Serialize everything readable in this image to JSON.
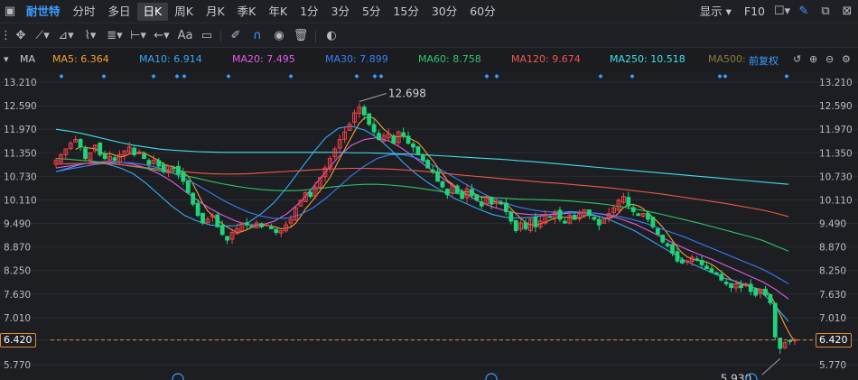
{
  "header": {
    "stock_name": "耐世特",
    "periods": [
      "分时",
      "多日",
      "日K",
      "周K",
      "月K",
      "季K",
      "年K",
      "1分",
      "3分",
      "5分",
      "15分",
      "30分",
      "60分"
    ],
    "active_period": "日K",
    "display_label": "显示",
    "f10_label": "F10"
  },
  "toolbar": {
    "text_tool_label": "Aa"
  },
  "indicator": {
    "label": "MA",
    "ma": [
      {
        "label": "MA5: 6.364",
        "color": "#f0a232"
      },
      {
        "label": "MA10: 6.914",
        "color": "#37a7f2"
      },
      {
        "label": "MA20: 7.495",
        "color": "#e05ce6"
      },
      {
        "label": "MA30: 7.899",
        "color": "#3a7df5"
      },
      {
        "label": "MA60: 8.758",
        "color": "#2fc46b"
      },
      {
        "label": "MA120: 9.674",
        "color": "#f0574d"
      },
      {
        "label": "MA250: 10.518",
        "color": "#3fe0e6"
      },
      {
        "label": "MA500:",
        "color": "#8a7b3c"
      }
    ],
    "adjust_label": "前复权"
  },
  "y_axis_labels": [
    "13.210",
    "12.590",
    "11.970",
    "11.350",
    "10.730",
    "10.110",
    "9.490",
    "8.870",
    "8.250",
    "7.630",
    "7.010",
    "6.420",
    "5.770"
  ],
  "price_tags": {
    "current_left": "6.420",
    "current_right": "6.420",
    "high_label": "12.698",
    "low_label": "5.930"
  },
  "colors": {
    "up": "#f0424a",
    "down": "#1fd37a",
    "current_line": "#e08a3c"
  },
  "chart_data": {
    "type": "candlestick",
    "y_range": [
      5.6,
      13.4
    ],
    "closes": [
      11.15,
      11.3,
      11.45,
      11.6,
      11.7,
      11.5,
      11.2,
      11.35,
      11.55,
      11.3,
      11.2,
      11.25,
      11.15,
      11.3,
      11.4,
      11.5,
      11.3,
      11.35,
      11.2,
      11.05,
      11.15,
      11.0,
      10.85,
      11.0,
      10.95,
      10.8,
      10.6,
      10.3,
      10.0,
      9.7,
      9.5,
      9.6,
      9.7,
      9.4,
      9.2,
      9.05,
      9.25,
      9.35,
      9.5,
      9.45,
      9.4,
      9.5,
      9.4,
      9.45,
      9.35,
      9.25,
      9.3,
      9.45,
      9.6,
      9.9,
      10.1,
      10.3,
      10.2,
      10.45,
      10.7,
      10.95,
      11.2,
      11.45,
      11.7,
      11.9,
      12.1,
      12.4,
      12.55,
      12.35,
      12.1,
      11.9,
      11.7,
      11.8,
      11.85,
      11.6,
      11.9,
      11.8,
      11.6,
      11.5,
      11.3,
      11.15,
      10.95,
      10.85,
      10.6,
      10.45,
      10.25,
      10.5,
      10.3,
      10.15,
      10.4,
      10.25,
      10.1,
      9.95,
      10.2,
      10.0,
      10.05,
      10.0,
      9.8,
      9.55,
      9.3,
      9.5,
      9.35,
      9.6,
      9.4,
      9.55,
      9.7,
      9.65,
      9.8,
      9.6,
      9.5,
      9.7,
      9.6,
      9.75,
      9.85,
      9.7,
      9.6,
      9.45,
      9.6,
      9.75,
      9.9,
      10.1,
      10.2,
      9.95,
      9.8,
      9.7,
      9.75,
      9.6,
      9.4,
      9.2,
      9.0,
      8.9,
      8.7,
      8.5,
      8.45,
      8.5,
      8.6,
      8.55,
      8.4,
      8.3,
      8.2,
      8.15,
      8.0,
      7.9,
      7.8,
      7.9,
      7.8,
      7.9,
      7.7,
      7.6,
      7.75,
      7.6,
      7.4,
      6.5,
      6.2,
      6.35,
      6.4,
      6.42
    ],
    "ma_series": [
      {
        "name": "MA10",
        "values": [
          10.85,
          10.95,
          11.05,
          11.1,
          11.05,
          10.95,
          10.8,
          10.55,
          10.25,
          9.95,
          9.7,
          9.55,
          9.45,
          9.42,
          9.43,
          9.52,
          9.75,
          10.05,
          10.45,
          10.9,
          11.35,
          11.75,
          12.0,
          12.05,
          11.95,
          11.75,
          11.45,
          11.1,
          10.8,
          10.55,
          10.35,
          10.15,
          10.0,
          9.85,
          9.72,
          9.65,
          9.63,
          9.65,
          9.7,
          9.76,
          9.8,
          9.78,
          9.7,
          9.6,
          9.45,
          9.3,
          9.1,
          8.9,
          8.7,
          8.5,
          8.35,
          8.2,
          8.05,
          7.95,
          7.85,
          7.65,
          7.3,
          6.91
        ]
      },
      {
        "name": "MA20",
        "values": [
          10.95,
          11.0,
          11.05,
          11.1,
          11.12,
          11.1,
          11.05,
          10.95,
          10.8,
          10.6,
          10.35,
          10.1,
          9.88,
          9.7,
          9.55,
          9.45,
          9.45,
          9.55,
          9.75,
          10.05,
          10.45,
          10.85,
          11.25,
          11.55,
          11.7,
          11.75,
          11.65,
          11.45,
          11.2,
          10.95,
          10.7,
          10.45,
          10.25,
          10.05,
          9.92,
          9.82,
          9.75,
          9.72,
          9.72,
          9.73,
          9.76,
          9.78,
          9.76,
          9.7,
          9.6,
          9.48,
          9.32,
          9.15,
          8.98,
          8.82,
          8.68,
          8.55,
          8.4,
          8.25,
          8.1,
          7.95,
          7.75,
          7.5
        ]
      },
      {
        "name": "MA30",
        "values": [
          10.85,
          10.92,
          10.98,
          11.04,
          11.08,
          11.1,
          11.08,
          11.03,
          10.95,
          10.83,
          10.68,
          10.5,
          10.3,
          10.1,
          9.93,
          9.78,
          9.68,
          9.62,
          9.63,
          9.72,
          9.9,
          10.15,
          10.45,
          10.75,
          11.0,
          11.2,
          11.3,
          11.3,
          11.22,
          11.08,
          10.9,
          10.7,
          10.5,
          10.32,
          10.15,
          10.02,
          9.92,
          9.85,
          9.8,
          9.78,
          9.77,
          9.77,
          9.76,
          9.72,
          9.66,
          9.58,
          9.48,
          9.36,
          9.24,
          9.12,
          8.98,
          8.84,
          8.7,
          8.56,
          8.42,
          8.28,
          8.1,
          7.9
        ]
      },
      {
        "name": "MA60",
        "values": [
          11.2,
          11.18,
          11.15,
          11.12,
          11.08,
          11.04,
          10.99,
          10.94,
          10.88,
          10.82,
          10.75,
          10.68,
          10.6,
          10.53,
          10.47,
          10.42,
          10.38,
          10.36,
          10.35,
          10.36,
          10.39,
          10.43,
          10.47,
          10.5,
          10.52,
          10.52,
          10.5,
          10.47,
          10.43,
          10.38,
          10.33,
          10.28,
          10.24,
          10.2,
          10.17,
          10.15,
          10.13,
          10.12,
          10.11,
          10.1,
          10.08,
          10.05,
          10.02,
          9.98,
          9.93,
          9.87,
          9.81,
          9.74,
          9.66,
          9.58,
          9.5,
          9.41,
          9.32,
          9.23,
          9.14,
          9.04,
          8.9,
          8.76
        ]
      },
      {
        "name": "MA120",
        "values": [
          11.05,
          11.06,
          11.07,
          11.07,
          11.06,
          11.04,
          11.0,
          10.96,
          10.92,
          10.88,
          10.85,
          10.82,
          10.8,
          10.79,
          10.79,
          10.8,
          10.82,
          10.84,
          10.86,
          10.88,
          10.9,
          10.92,
          10.93,
          10.94,
          10.94,
          10.93,
          10.92,
          10.9,
          10.88,
          10.85,
          10.82,
          10.78,
          10.75,
          10.72,
          10.69,
          10.66,
          10.63,
          10.6,
          10.57,
          10.55,
          10.52,
          10.49,
          10.46,
          10.43,
          10.39,
          10.35,
          10.31,
          10.27,
          10.22,
          10.17,
          10.12,
          10.07,
          10.02,
          9.96,
          9.9,
          9.84,
          9.76,
          9.67
        ]
      },
      {
        "name": "MA250",
        "values": [
          11.97,
          11.92,
          11.86,
          11.78,
          11.7,
          11.62,
          11.55,
          11.5,
          11.45,
          11.42,
          11.4,
          11.38,
          11.37,
          11.36,
          11.36,
          11.36,
          11.36,
          11.36,
          11.36,
          11.36,
          11.36,
          11.36,
          11.36,
          11.35,
          11.35,
          11.34,
          11.33,
          11.32,
          11.31,
          11.29,
          11.27,
          11.25,
          11.23,
          11.21,
          11.19,
          11.17,
          11.14,
          11.12,
          11.09,
          11.06,
          11.03,
          11.0,
          10.97,
          10.94,
          10.91,
          10.88,
          10.85,
          10.82,
          10.79,
          10.76,
          10.73,
          10.7,
          10.67,
          10.64,
          10.61,
          10.58,
          10.55,
          10.52
        ]
      }
    ],
    "high": 12.698,
    "low": 5.93,
    "current": 6.42
  }
}
